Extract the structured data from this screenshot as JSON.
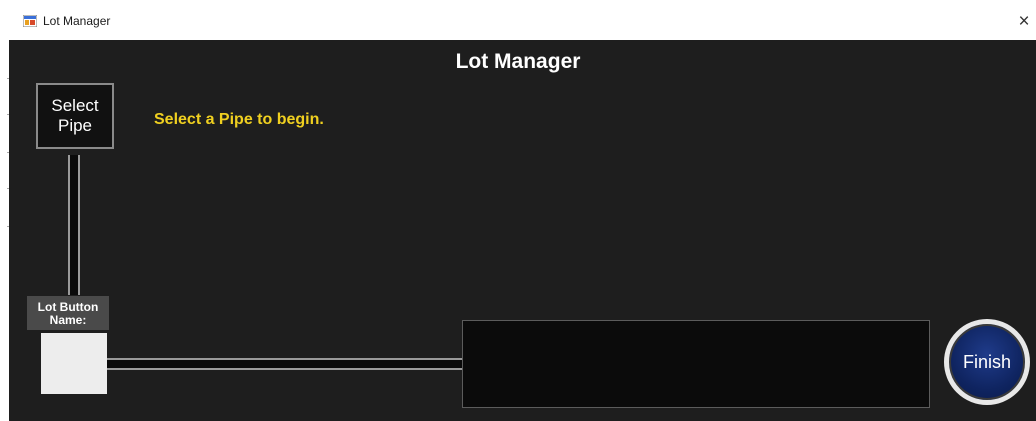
{
  "window": {
    "title": "Lot Manager",
    "close_glyph": "×",
    "app_icon": "app-window-icon"
  },
  "header": {
    "title": "Lot Manager"
  },
  "controls": {
    "select_pipe_label": "Select Pipe",
    "instruction_text": "Select a Pipe to begin.",
    "lot_button_name_label": "Lot Button Name:",
    "finish_label": "Finish"
  },
  "colors": {
    "background": "#1e1e1e",
    "instruction_text": "#f0d020",
    "finish_button": "#0f2460",
    "lot_swatch": "#ededed"
  }
}
